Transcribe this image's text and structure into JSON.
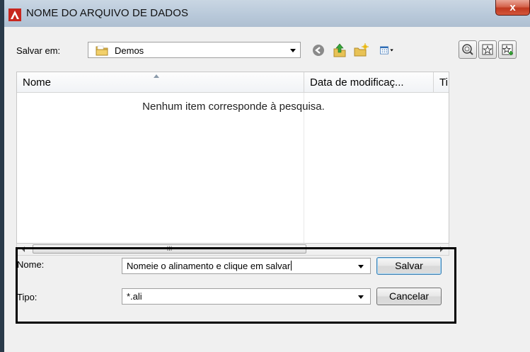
{
  "window": {
    "title": "NOME DO ARQUIVO DE DADOS",
    "close_label": "x"
  },
  "toolbar": {
    "save_in_label": "Salvar em:",
    "save_in_value": "Demos",
    "icons": [
      "back-icon",
      "up-folder-icon",
      "new-folder-icon",
      "view-menu-icon",
      "search-web-icon",
      "favorites-icon",
      "add-favorite-icon"
    ]
  },
  "file_list": {
    "columns": [
      "Nome",
      "Data de modificaç...",
      "Ti"
    ],
    "empty_message": "Nenhum item corresponde à pesquisa.",
    "scroll_grip": "III"
  },
  "form": {
    "name_label": "Nome:",
    "name_value": "Nomeie o alinamento e clique em salvar",
    "type_label": "Tipo:",
    "type_value": "*.ali",
    "save_button": "Salvar",
    "cancel_button": "Cancelar"
  },
  "colors": {
    "title_bar": "#b9c9da",
    "close_button": "#c0391f",
    "app_icon": "#c8261e",
    "highlight_border": "#000000"
  }
}
